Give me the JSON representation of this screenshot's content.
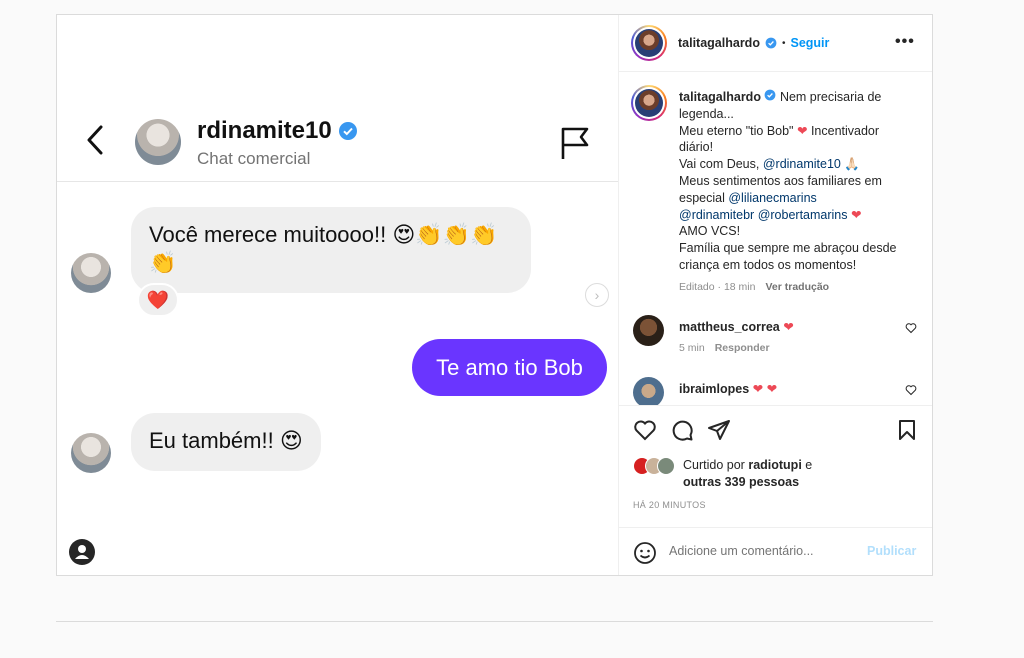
{
  "chat": {
    "name": "rdinamite10",
    "subtitle": "Chat comercial",
    "message1": "Você merece muitoooo!! 😍👏👏👏👏",
    "reaction": "❤️",
    "sent_message": "Te amo tio Bob",
    "message2": "Eu também!! 😍"
  },
  "post": {
    "author": "talitagalhardo",
    "dot": "•",
    "follow_label": "Seguir",
    "caption_author": "talitagalhardo",
    "caption_line1": "Nem precisaria de legenda...",
    "caption_line2a": "Meu eterno \"tio Bob\"",
    "caption_heart": "❤",
    "caption_line2b": "Incentivador diário!",
    "caption_line3a": "Vai com Deus,",
    "caption_mention1": "@rdinamite10",
    "caption_line3_emoji": "🙏🏻",
    "caption_line4": "Meus sentimentos aos familiares em especial",
    "caption_mention2": "@lilianecmarins",
    "caption_mention3": "@rdinamitebr",
    "caption_mention4": "@robertamarins",
    "caption_heart2": "❤",
    "caption_line5": "AMO VCS!",
    "caption_line6": "Família que sempre me abraçou desde criança em todos os momentos!",
    "caption_edited": "Editado · 18 min",
    "caption_translate": "Ver tradução"
  },
  "comments": [
    {
      "user": "mattheus_correa",
      "text": "❤",
      "time": "5 min",
      "reply": "Responder"
    },
    {
      "user": "ibraimlopes",
      "text": "❤ ❤"
    }
  ],
  "likes": {
    "prefix": "Curtido por",
    "user": "radiotupi",
    "connector": "e",
    "others": "outras 339 pessoas"
  },
  "timestamp": "HÁ 20 MINUTOS",
  "add_comment": {
    "placeholder": "Adicione um comentário...",
    "publish": "Publicar"
  },
  "colors": {
    "sent_bubble": "#6a35ff",
    "link": "#0095f6",
    "heart": "#ed4956"
  }
}
